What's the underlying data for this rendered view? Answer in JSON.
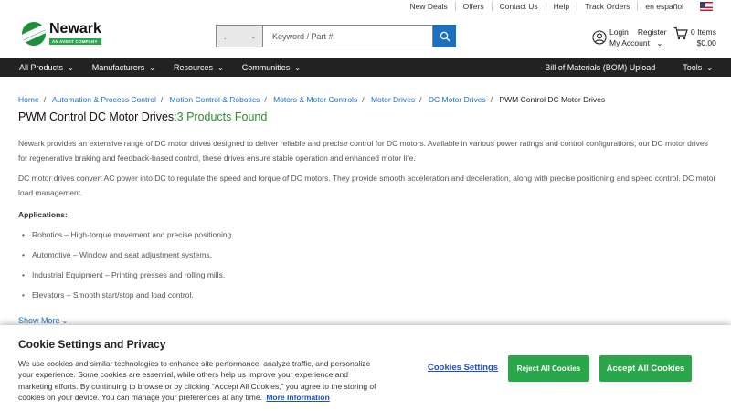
{
  "utility_links": [
    "New Deals",
    "Offers",
    "Contact Us",
    "Help",
    "Track Orders",
    "en español"
  ],
  "logo": {
    "name": "Newark",
    "sub": "AN AVNET COMPANY"
  },
  "search": {
    "placeholder": "Keyword / Part #",
    "select_value": "."
  },
  "account": {
    "login": "Login",
    "register": "Register",
    "my_account": "My Account"
  },
  "cart": {
    "items": "0 Items",
    "total": "$0.00"
  },
  "nav": {
    "items": [
      "All Products",
      "Manufacturers",
      "Resources",
      "Communities"
    ],
    "bom": "Bill of Materials (BOM) Upload",
    "tools": "Tools"
  },
  "breadcrumb": [
    "Home",
    "Automation & Process Control",
    "Motion Control & Robotics",
    "Motors & Motor Controls",
    "Motor Drives",
    "DC Motor Drives"
  ],
  "breadcrumb_current": "PWM Control DC Motor Drives",
  "title": {
    "main": "PWM Control DC Motor Drives:",
    "count": "3 Products Found"
  },
  "content": {
    "p1a": "Newark provides an extensive range of DC motor drives designed to deliver reliable and precise control for DC motors. Available in various power ratings and control configurations, our DC motor drives",
    "p1b": "for regenerative braking and feedback-based control, these drives ensure stable operation and enhanced motor life.",
    "p2a": "DC motor drives convert AC power into DC to regulate the speed and torque of DC motors. They provide smooth acceleration and deceleration, along with precise positioning and speed control. DC motor",
    "p2b": "load management.",
    "apps_heading": "Applications:",
    "apps": [
      "Robotics – High-torque movement and precise positioning.",
      "Automotive – Window and seat adjustment systems.",
      "Industrial Equipment – Printing presses and rolling mills.",
      "Elevators – Smooth start/stop and load control."
    ],
    "show_more": "Show More"
  },
  "cookie": {
    "title": "Cookie Settings and Privacy",
    "body": "We use cookies and similar technologies to enhance site performance, analyze traffic, and personalize your experience. Some cookies are essential, while others help us improve your experience and marketing efforts. By continuing to browse or by clicking “Accept All Cookies,” you agree to the storing of cookies on your device. You can manage your preferences at any time.",
    "more_info": "More Information",
    "settings": "Cookies Settings",
    "reject": "Reject All Cookies",
    "accept": "Accept All Cookies"
  },
  "colors": {
    "brand_green": "#2aa74a",
    "link_blue": "#1d6fc2",
    "nav_bg": "#222222"
  }
}
